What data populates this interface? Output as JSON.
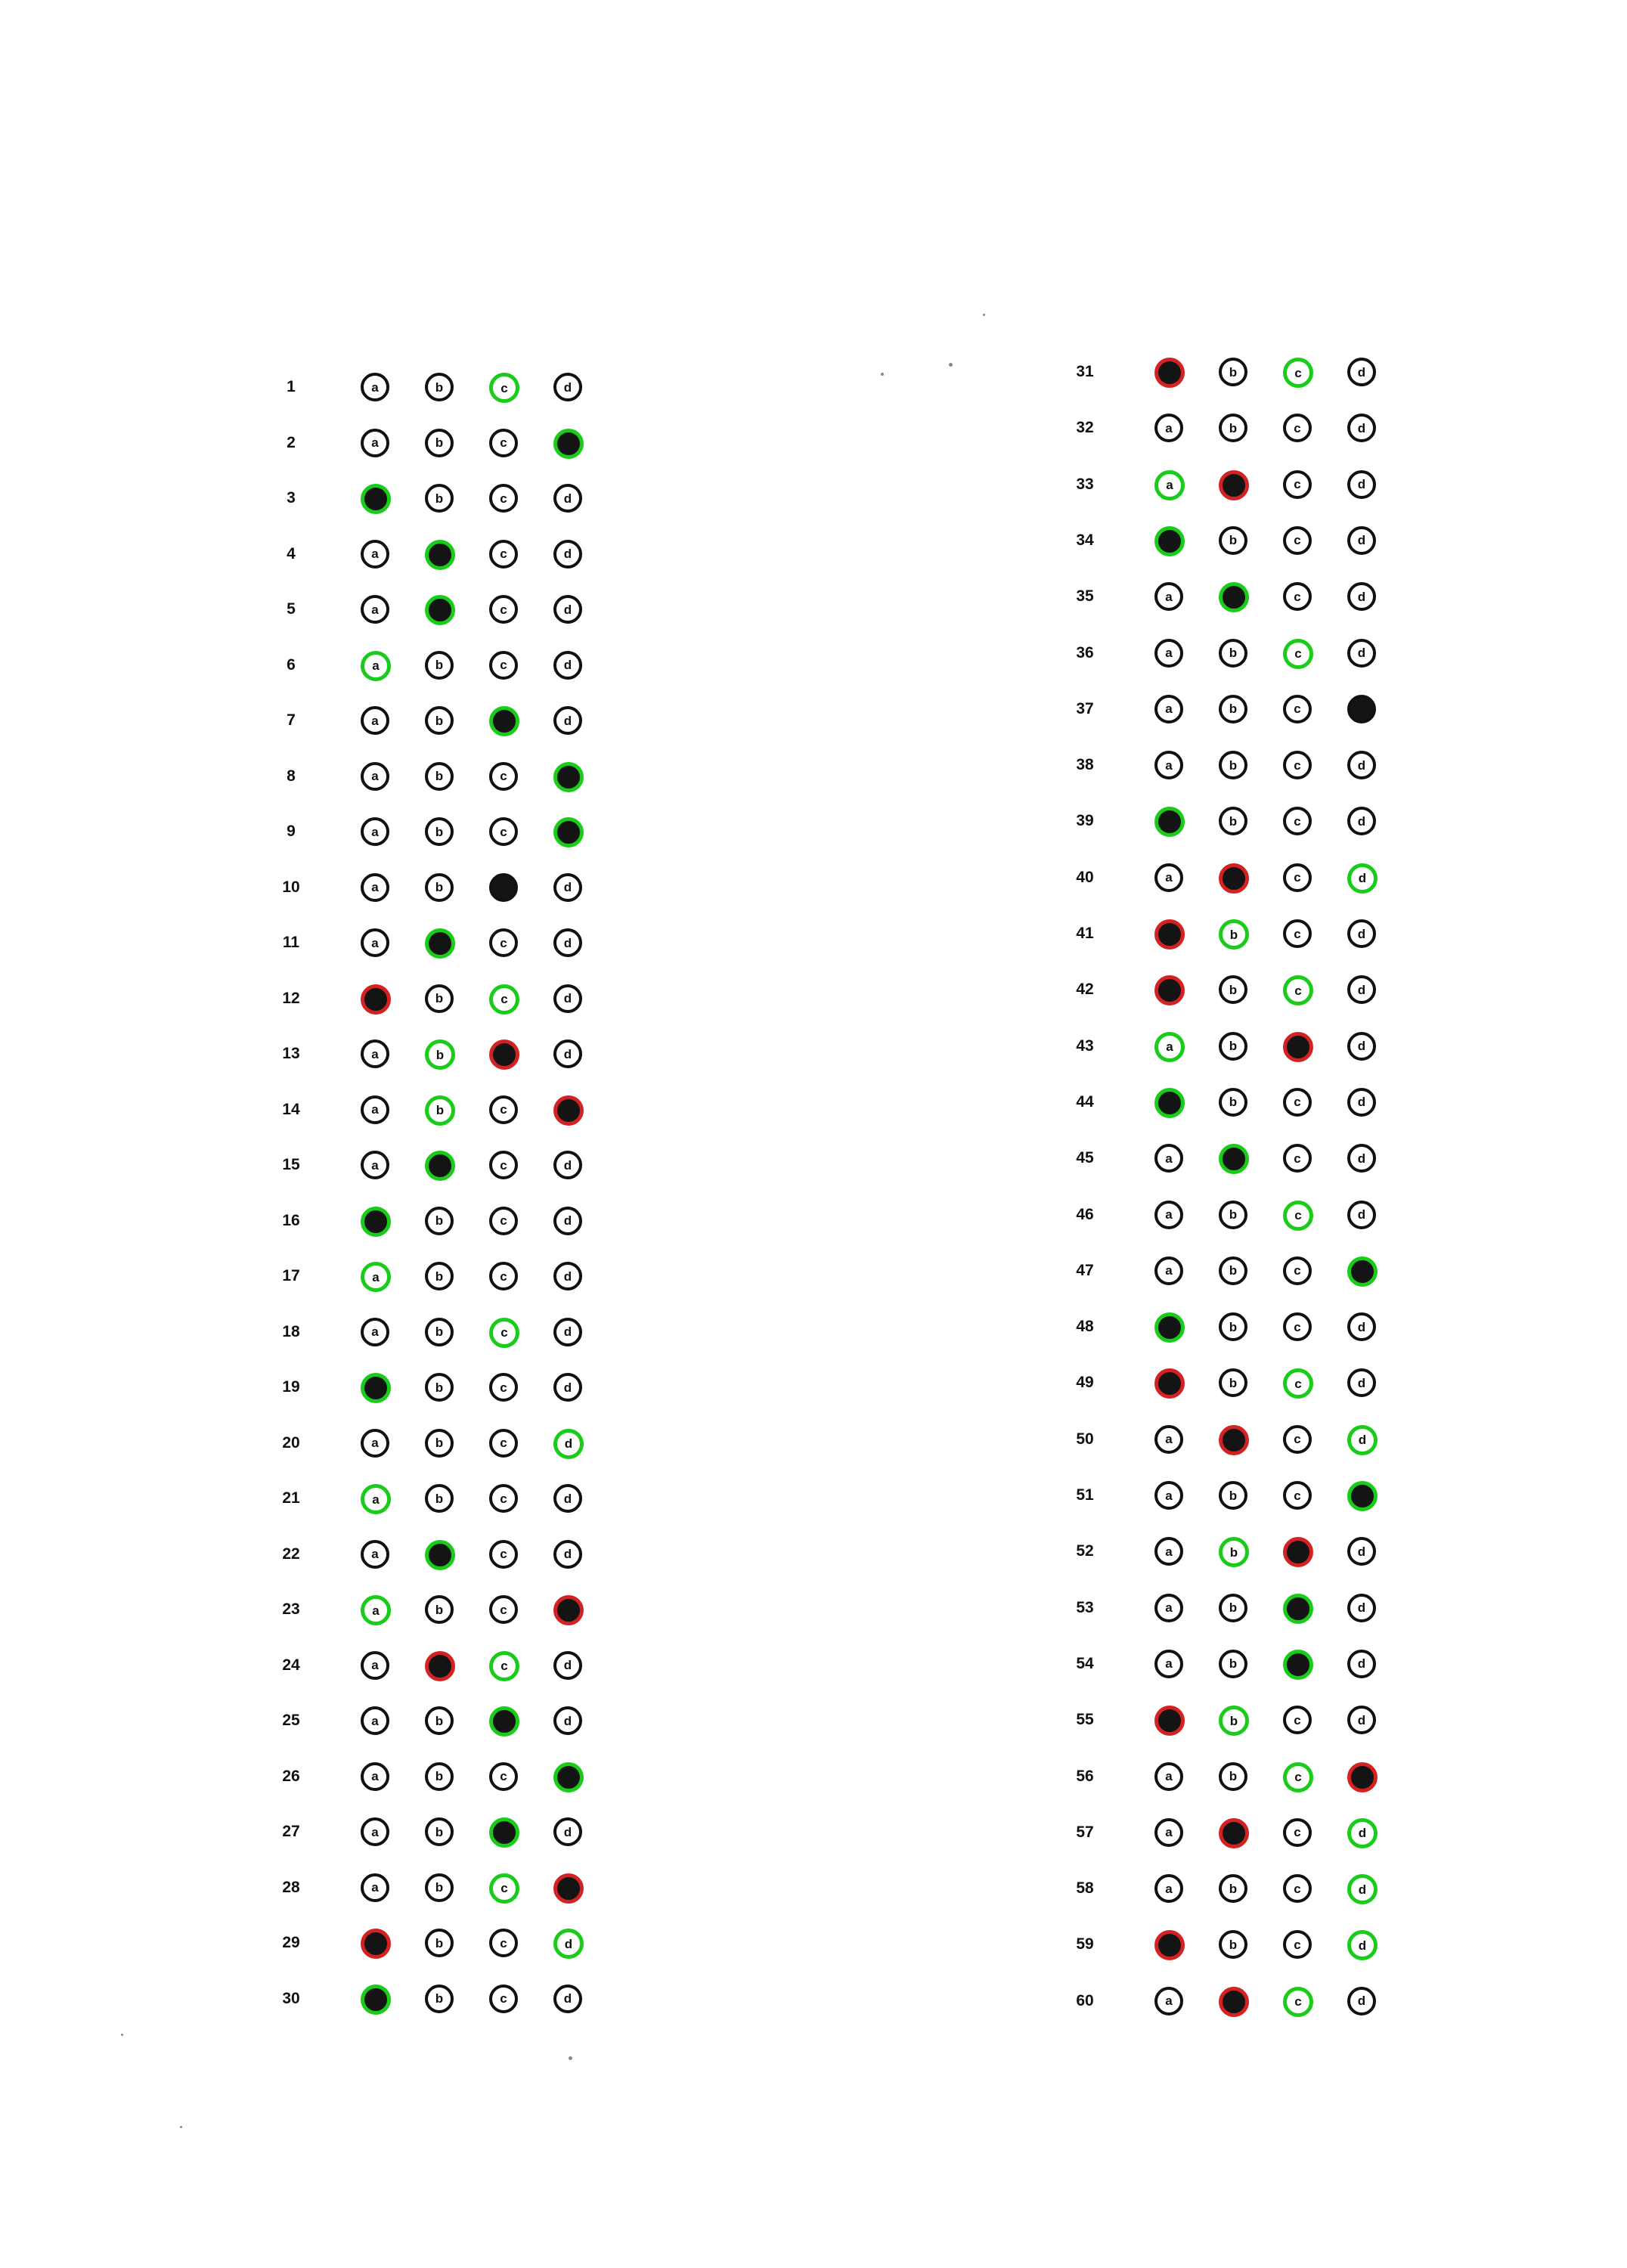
{
  "sheet": {
    "left_column": [
      {
        "q": "1",
        "answers": {
          "a": "empty",
          "b": "empty",
          "c": "correct-key",
          "d": "empty"
        }
      },
      {
        "q": "2",
        "answers": {
          "a": "empty",
          "b": "empty",
          "c": "empty",
          "d": "correct-filled"
        }
      },
      {
        "q": "3",
        "answers": {
          "a": "correct-filled",
          "b": "empty",
          "c": "empty",
          "d": "empty"
        }
      },
      {
        "q": "4",
        "answers": {
          "a": "empty",
          "b": "correct-filled",
          "c": "empty",
          "d": "empty"
        }
      },
      {
        "q": "5",
        "answers": {
          "a": "empty",
          "b": "correct-filled",
          "c": "empty",
          "d": "empty"
        }
      },
      {
        "q": "6",
        "answers": {
          "a": "correct-key",
          "b": "empty",
          "c": "empty",
          "d": "empty"
        }
      },
      {
        "q": "7",
        "answers": {
          "a": "empty",
          "b": "empty",
          "c": "correct-filled",
          "d": "empty"
        }
      },
      {
        "q": "8",
        "answers": {
          "a": "empty",
          "b": "empty",
          "c": "empty",
          "d": "correct-filled"
        }
      },
      {
        "q": "9",
        "answers": {
          "a": "empty",
          "b": "empty",
          "c": "empty",
          "d": "correct-filled"
        }
      },
      {
        "q": "10",
        "answers": {
          "a": "empty",
          "b": "empty",
          "c": "filled",
          "d": "empty"
        }
      },
      {
        "q": "11",
        "answers": {
          "a": "empty",
          "b": "correct-filled",
          "c": "empty",
          "d": "empty"
        }
      },
      {
        "q": "12",
        "answers": {
          "a": "wrong-filled",
          "b": "empty",
          "c": "correct-key",
          "d": "empty"
        }
      },
      {
        "q": "13",
        "answers": {
          "a": "empty",
          "b": "correct-key",
          "c": "wrong-filled",
          "d": "empty"
        }
      },
      {
        "q": "14",
        "answers": {
          "a": "empty",
          "b": "correct-key",
          "c": "empty",
          "d": "wrong-filled"
        }
      },
      {
        "q": "15",
        "answers": {
          "a": "empty",
          "b": "correct-filled",
          "c": "empty",
          "d": "empty"
        }
      },
      {
        "q": "16",
        "answers": {
          "a": "correct-filled",
          "b": "empty",
          "c": "empty",
          "d": "empty"
        }
      },
      {
        "q": "17",
        "answers": {
          "a": "correct-key",
          "b": "empty",
          "c": "empty",
          "d": "empty"
        }
      },
      {
        "q": "18",
        "answers": {
          "a": "empty",
          "b": "empty",
          "c": "correct-key",
          "d": "empty"
        }
      },
      {
        "q": "19",
        "answers": {
          "a": "correct-filled",
          "b": "empty",
          "c": "empty",
          "d": "empty"
        }
      },
      {
        "q": "20",
        "answers": {
          "a": "empty",
          "b": "empty",
          "c": "empty",
          "d": "correct-key"
        }
      },
      {
        "q": "21",
        "answers": {
          "a": "correct-key",
          "b": "empty",
          "c": "empty",
          "d": "empty"
        }
      },
      {
        "q": "22",
        "answers": {
          "a": "empty",
          "b": "correct-filled",
          "c": "empty",
          "d": "empty"
        }
      },
      {
        "q": "23",
        "answers": {
          "a": "correct-key",
          "b": "empty",
          "c": "empty",
          "d": "wrong-filled"
        }
      },
      {
        "q": "24",
        "answers": {
          "a": "empty",
          "b": "wrong-filled",
          "c": "correct-key",
          "d": "empty"
        }
      },
      {
        "q": "25",
        "answers": {
          "a": "empty",
          "b": "empty",
          "c": "correct-filled",
          "d": "empty"
        }
      },
      {
        "q": "26",
        "answers": {
          "a": "empty",
          "b": "empty",
          "c": "empty",
          "d": "correct-filled"
        }
      },
      {
        "q": "27",
        "answers": {
          "a": "empty",
          "b": "empty",
          "c": "correct-filled",
          "d": "empty"
        }
      },
      {
        "q": "28",
        "answers": {
          "a": "empty",
          "b": "empty",
          "c": "correct-key",
          "d": "wrong-filled"
        }
      },
      {
        "q": "29",
        "answers": {
          "a": "wrong-filled",
          "b": "empty",
          "c": "empty",
          "d": "correct-key"
        }
      },
      {
        "q": "30",
        "answers": {
          "a": "correct-filled",
          "b": "empty",
          "c": "empty",
          "d": "empty"
        }
      }
    ],
    "right_column": [
      {
        "q": "31",
        "answers": {
          "a": "wrong-filled",
          "b": "empty",
          "c": "correct-key",
          "d": "empty"
        }
      },
      {
        "q": "32",
        "answers": {
          "a": "empty",
          "b": "empty",
          "c": "empty",
          "d": "empty"
        }
      },
      {
        "q": "33",
        "answers": {
          "a": "correct-key",
          "b": "wrong-filled",
          "c": "empty",
          "d": "empty"
        }
      },
      {
        "q": "34",
        "answers": {
          "a": "correct-filled",
          "b": "empty",
          "c": "empty",
          "d": "empty"
        }
      },
      {
        "q": "35",
        "answers": {
          "a": "empty",
          "b": "correct-filled",
          "c": "empty",
          "d": "empty"
        }
      },
      {
        "q": "36",
        "answers": {
          "a": "empty",
          "b": "empty",
          "c": "correct-key",
          "d": "empty"
        }
      },
      {
        "q": "37",
        "answers": {
          "a": "empty",
          "b": "empty",
          "c": "empty",
          "d": "filled"
        }
      },
      {
        "q": "38",
        "answers": {
          "a": "empty",
          "b": "empty",
          "c": "empty",
          "d": "empty"
        }
      },
      {
        "q": "39",
        "answers": {
          "a": "correct-filled",
          "b": "empty",
          "c": "empty",
          "d": "empty"
        }
      },
      {
        "q": "40",
        "answers": {
          "a": "empty",
          "b": "wrong-filled",
          "c": "empty",
          "d": "correct-key"
        }
      },
      {
        "q": "41",
        "answers": {
          "a": "wrong-filled",
          "b": "correct-key",
          "c": "empty",
          "d": "empty"
        }
      },
      {
        "q": "42",
        "answers": {
          "a": "wrong-filled",
          "b": "empty",
          "c": "correct-key",
          "d": "empty"
        }
      },
      {
        "q": "43",
        "answers": {
          "a": "correct-key",
          "b": "empty",
          "c": "wrong-filled",
          "d": "empty"
        }
      },
      {
        "q": "44",
        "answers": {
          "a": "correct-filled",
          "b": "empty",
          "c": "empty",
          "d": "empty"
        }
      },
      {
        "q": "45",
        "answers": {
          "a": "empty",
          "b": "correct-filled",
          "c": "empty",
          "d": "empty"
        }
      },
      {
        "q": "46",
        "answers": {
          "a": "empty",
          "b": "empty",
          "c": "correct-key",
          "d": "empty"
        }
      },
      {
        "q": "47",
        "answers": {
          "a": "empty",
          "b": "empty",
          "c": "empty",
          "d": "correct-filled"
        }
      },
      {
        "q": "48",
        "answers": {
          "a": "correct-filled",
          "b": "empty",
          "c": "empty",
          "d": "empty"
        }
      },
      {
        "q": "49",
        "answers": {
          "a": "wrong-filled",
          "b": "empty",
          "c": "correct-key",
          "d": "empty"
        }
      },
      {
        "q": "50",
        "answers": {
          "a": "empty",
          "b": "wrong-filled",
          "c": "empty",
          "d": "correct-key"
        }
      },
      {
        "q": "51",
        "answers": {
          "a": "empty",
          "b": "empty",
          "c": "empty",
          "d": "correct-filled"
        }
      },
      {
        "q": "52",
        "answers": {
          "a": "empty",
          "b": "correct-key",
          "c": "wrong-filled",
          "d": "empty"
        }
      },
      {
        "q": "53",
        "answers": {
          "a": "empty",
          "b": "empty",
          "c": "correct-filled",
          "d": "empty"
        }
      },
      {
        "q": "54",
        "answers": {
          "a": "empty",
          "b": "empty",
          "c": "correct-filled",
          "d": "empty"
        }
      },
      {
        "q": "55",
        "answers": {
          "a": "wrong-filled",
          "b": "correct-key",
          "c": "empty",
          "d": "empty"
        }
      },
      {
        "q": "56",
        "answers": {
          "a": "empty",
          "b": "empty",
          "c": "correct-key",
          "d": "wrong-filled"
        }
      },
      {
        "q": "57",
        "answers": {
          "a": "empty",
          "b": "wrong-filled",
          "c": "empty",
          "d": "correct-key"
        }
      },
      {
        "q": "58",
        "answers": {
          "a": "empty",
          "b": "empty",
          "c": "empty",
          "d": "correct-key"
        }
      },
      {
        "q": "59",
        "answers": {
          "a": "wrong-filled",
          "b": "empty",
          "c": "empty",
          "d": "correct-key"
        }
      },
      {
        "q": "60",
        "answers": {
          "a": "empty",
          "b": "wrong-filled",
          "c": "correct-key",
          "d": "empty"
        }
      }
    ],
    "option_letters": [
      "a",
      "b",
      "c",
      "d"
    ]
  },
  "colors": {
    "correct": "#19cc19",
    "wrong": "#d42121",
    "ink": "#141414",
    "paper": "#ffffff"
  }
}
